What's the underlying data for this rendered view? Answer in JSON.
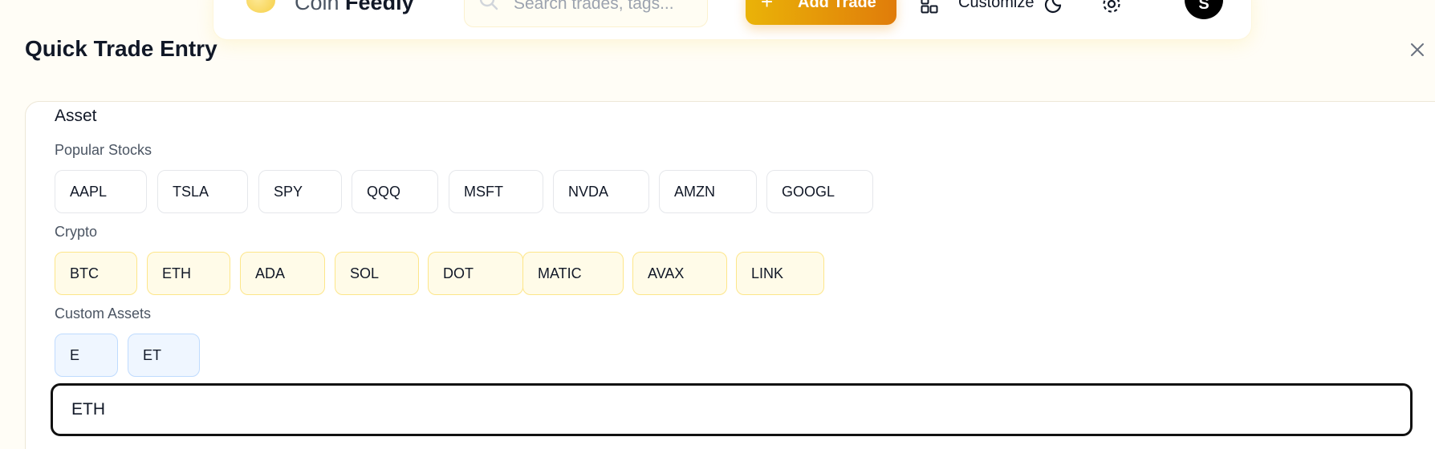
{
  "nav": {
    "brand_part1": "Coin",
    "brand_part2": "Feedly",
    "search_placeholder": "Search trades, tags...",
    "add_trade_label": "Add Trade",
    "add_icon": "+",
    "customize_label": "Customize",
    "avatar_initial": "S"
  },
  "dialog": {
    "title": "Quick Trade Entry"
  },
  "asset": {
    "label": "Asset",
    "popular_label": "Popular Stocks",
    "popular": [
      "AAPL",
      "TSLA",
      "SPY",
      "QQQ",
      "MSFT",
      "NVDA",
      "AMZN",
      "GOOGL"
    ],
    "crypto_label": "Crypto",
    "crypto": [
      "BTC",
      "ETH",
      "ADA",
      "SOL",
      "DOT",
      "MATIC",
      "AVAX",
      "LINK"
    ],
    "custom_label": "Custom Assets",
    "custom": [
      "E",
      "ET"
    ],
    "input_value": "ETH"
  },
  "colors": {
    "page_bg": "#fffdf6",
    "accent_start": "#eab308",
    "accent_end": "#e07c0a",
    "crypto_chip_bg": "#fffbe8",
    "crypto_chip_border": "#fde68a",
    "custom_chip_bg": "#eff6ff",
    "custom_chip_border": "#bfdbfe"
  },
  "icons": [
    "coin-logo-icon",
    "search-icon",
    "plus-icon",
    "layout-grid-icon",
    "moon-icon",
    "gear-icon",
    "close-icon"
  ]
}
